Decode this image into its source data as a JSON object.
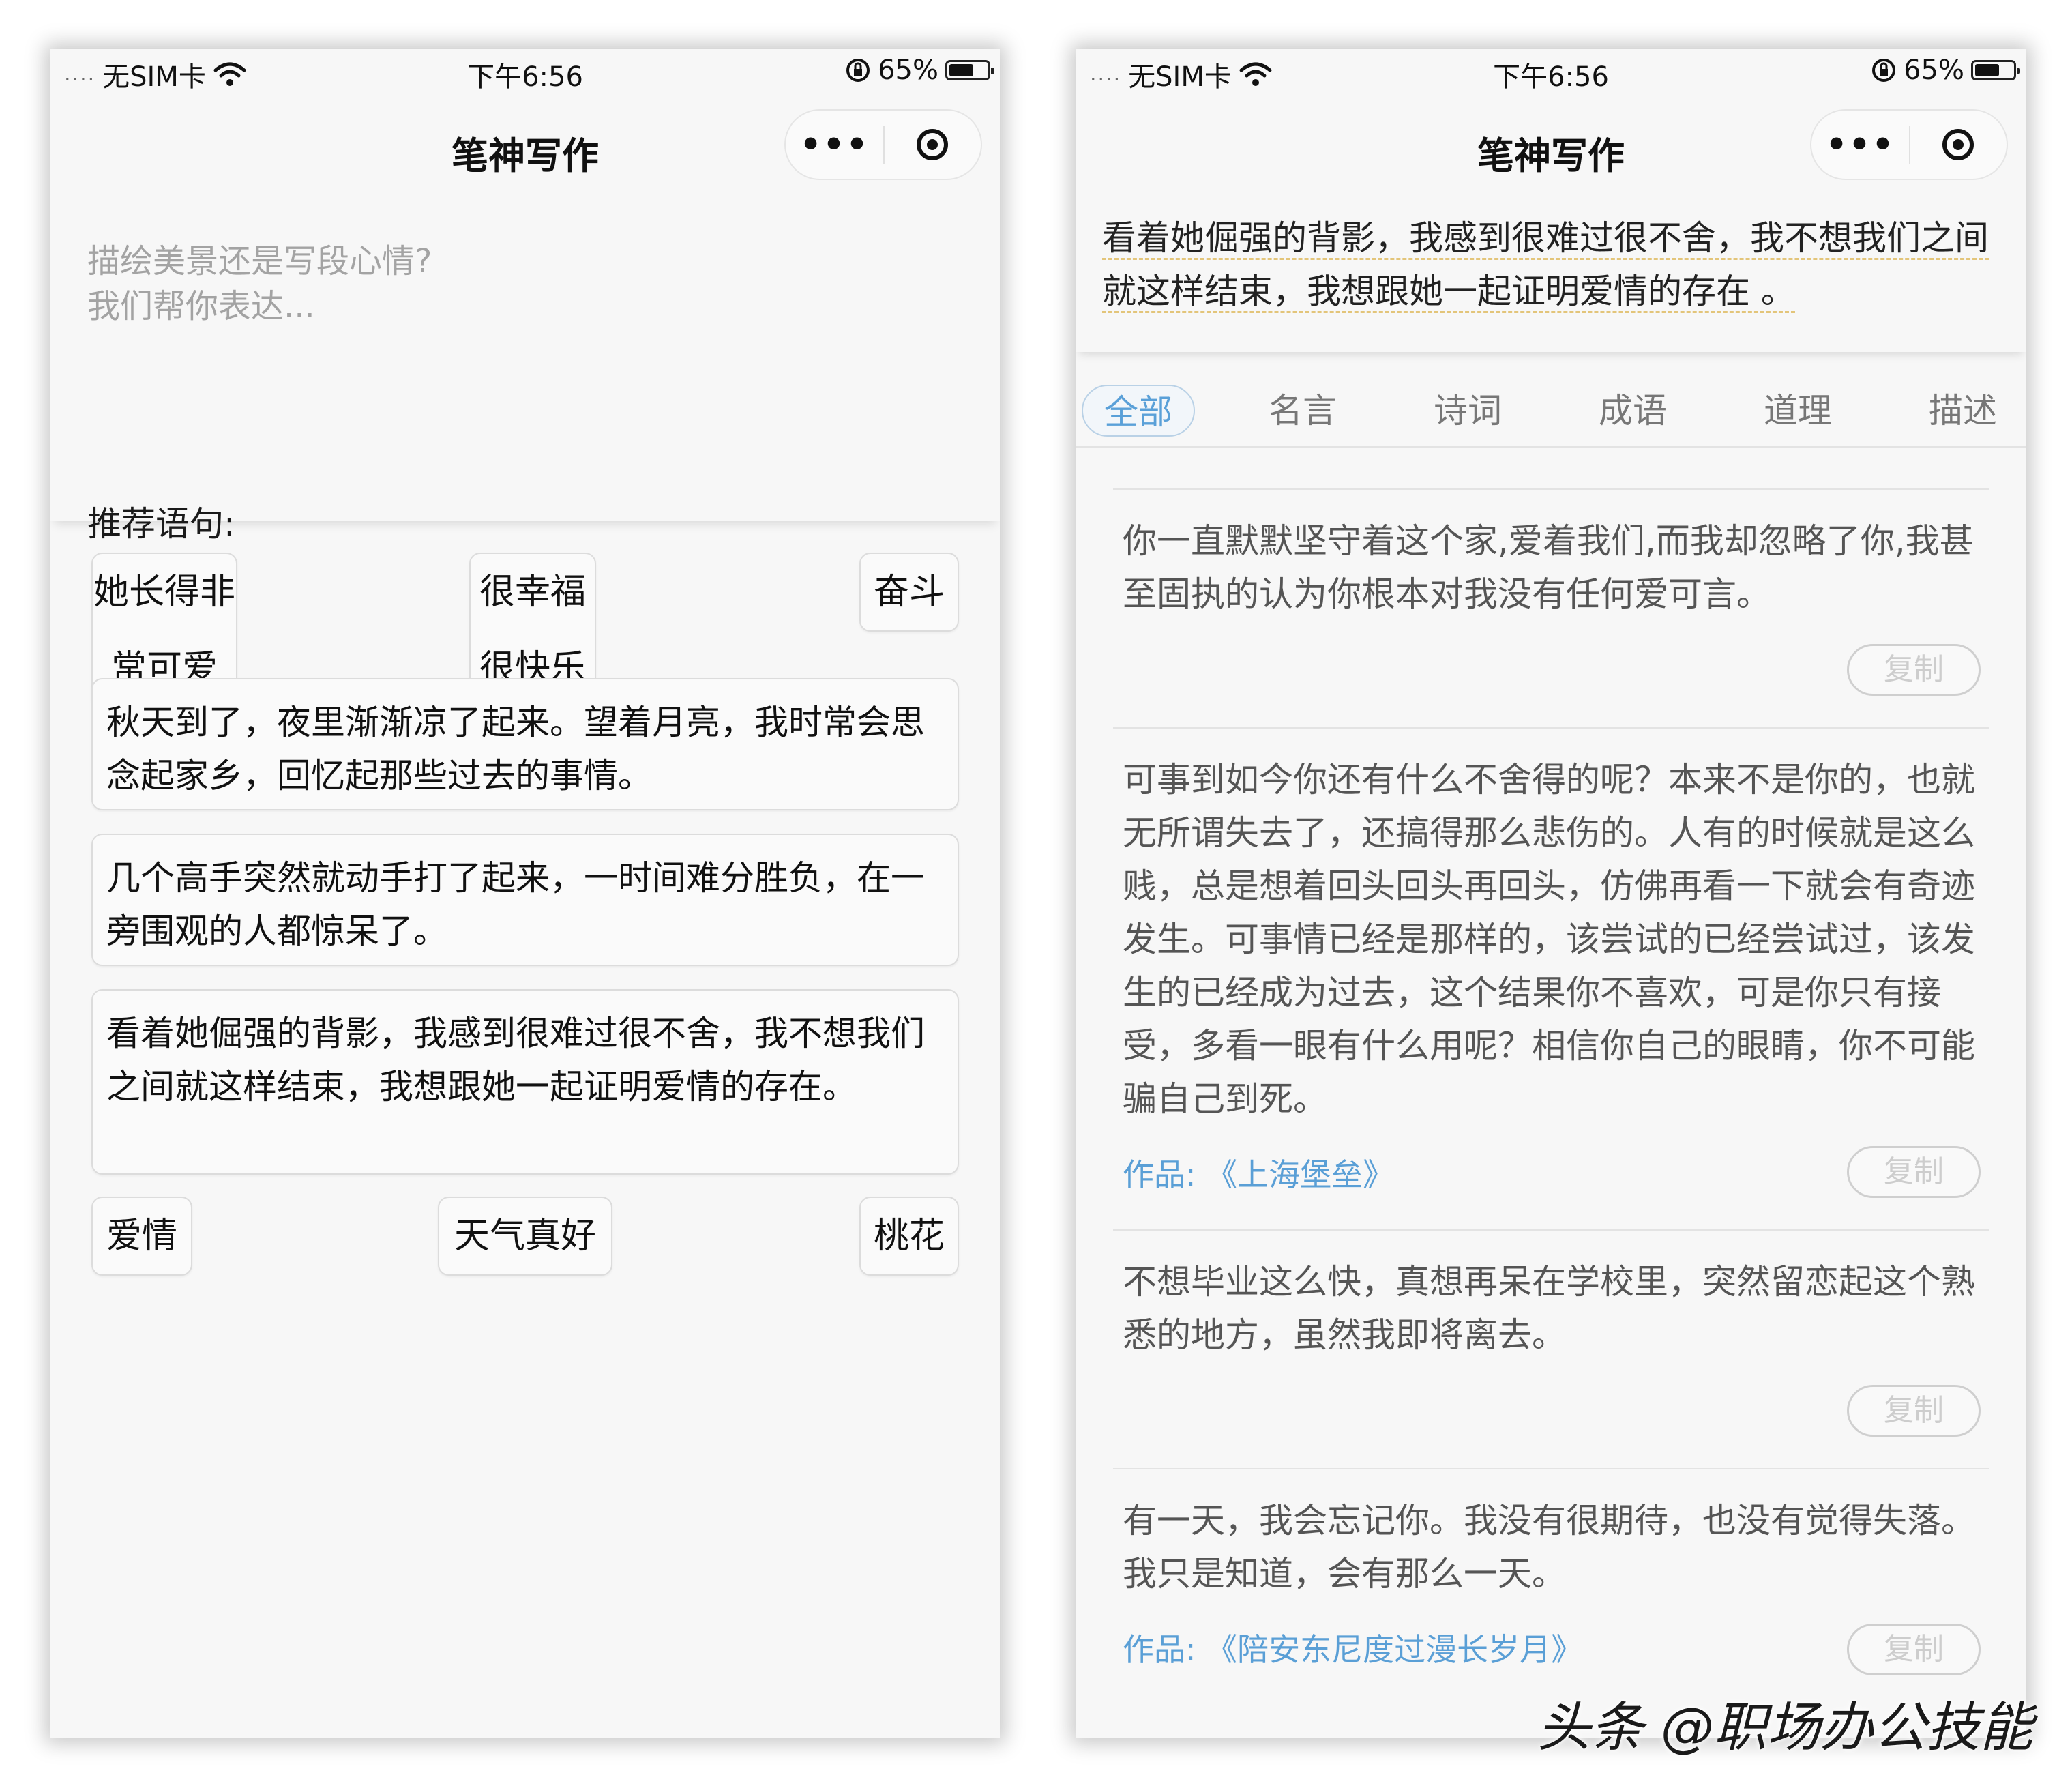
{
  "status_bar": {
    "signal_dots": "....",
    "carrier": "无SIM卡",
    "time": "下午6:56",
    "battery": "65%",
    "battery_level": 0.65
  },
  "nav": {
    "title": "笔神写作",
    "more_glyph": "•••",
    "icons": [
      "wifi-icon",
      "rotation-lock-icon",
      "battery-icon",
      "more-icon",
      "target-icon"
    ]
  },
  "left": {
    "placeholder": "描绘美景还是写段心情?\n我们帮你表达...",
    "recommend_label": "推荐语句:",
    "chips_row1": [
      "她长得非常可爱",
      "很幸福很快乐",
      "奋斗"
    ],
    "sentences": [
      "秋天到了，夜里渐渐凉了起来。望着月亮，我时常会思念起家乡，回忆起那些过去的事情。",
      "几个高手突然就动手打了起来，一时间难分胜负，在一旁围观的人都惊呆了。",
      "看着她倔强的背影，我感到很难过很不舍，我不想我们之间就这样结束，我想跟她一起证明爱情的存在。"
    ],
    "chips_row2": [
      "爱情",
      "天气真好",
      "桃花"
    ]
  },
  "right": {
    "input_text": "看着她倔强的背影，我感到很难过很不舍，我不想我们之间就这样结束，我想跟她一起证明爱情的存在 。",
    "tabs": [
      "全部",
      "名言",
      "诗词",
      "成语",
      "道理",
      "描述"
    ],
    "active_tab": "全部",
    "work_label": "作品:",
    "copy_label": "复制",
    "results": [
      {
        "text": "你一直默默坚守着这个家,爱着我们,而我却忽略了你,我甚至固执的认为你根本对我没有任何爱可言。",
        "work": ""
      },
      {
        "text": "可事到如今你还有什么不舍得的呢？本来不是你的，也就无所谓失去了，还搞得那么悲伤的。人有的时候就是这么贱，总是想着回头回头再回头，仿佛再看一下就会有奇迹发生。可事情已经是那样的，该尝试的已经尝试过，该发生的已经成为过去，这个结果你不喜欢，可是你只有接受，多看一眼有什么用呢？相信你自己的眼睛，你不可能骗自己到死。",
        "work": "《上海堡垒》"
      },
      {
        "text": "不想毕业这么快，真想再呆在学校里，突然留恋起这个熟悉的地方，虽然我即将离去。",
        "work": ""
      },
      {
        "text": "有一天，我会忘记你。我没有很期待，也没有觉得失落。我只是知道，会有那么一天。",
        "work": "《陪安东尼度过漫长岁月》"
      }
    ]
  },
  "watermark": "头条 @职场办公技能"
}
